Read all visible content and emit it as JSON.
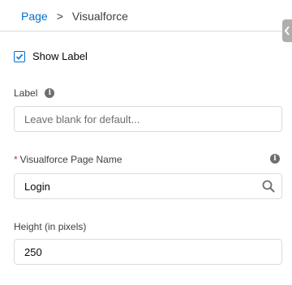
{
  "breadcrumb": {
    "parent": "Page",
    "separator": ">",
    "current": "Visualforce"
  },
  "show_label": {
    "label": "Show Label",
    "checked": true
  },
  "label_field": {
    "label": "Label",
    "placeholder": "Leave blank for default...",
    "value": ""
  },
  "page_name_field": {
    "required_marker": "*",
    "label": "Visualforce Page Name",
    "value": "Login"
  },
  "height_field": {
    "label": "Height (in pixels)",
    "value": "250"
  },
  "icons": {
    "info": "info-icon",
    "search": "search-icon",
    "collapse": "chevron-left-icon",
    "check": "checkmark-icon"
  },
  "colors": {
    "link": "#0070d2",
    "required": "#c23934",
    "border": "#dddbda",
    "icon": "#706e6b"
  }
}
